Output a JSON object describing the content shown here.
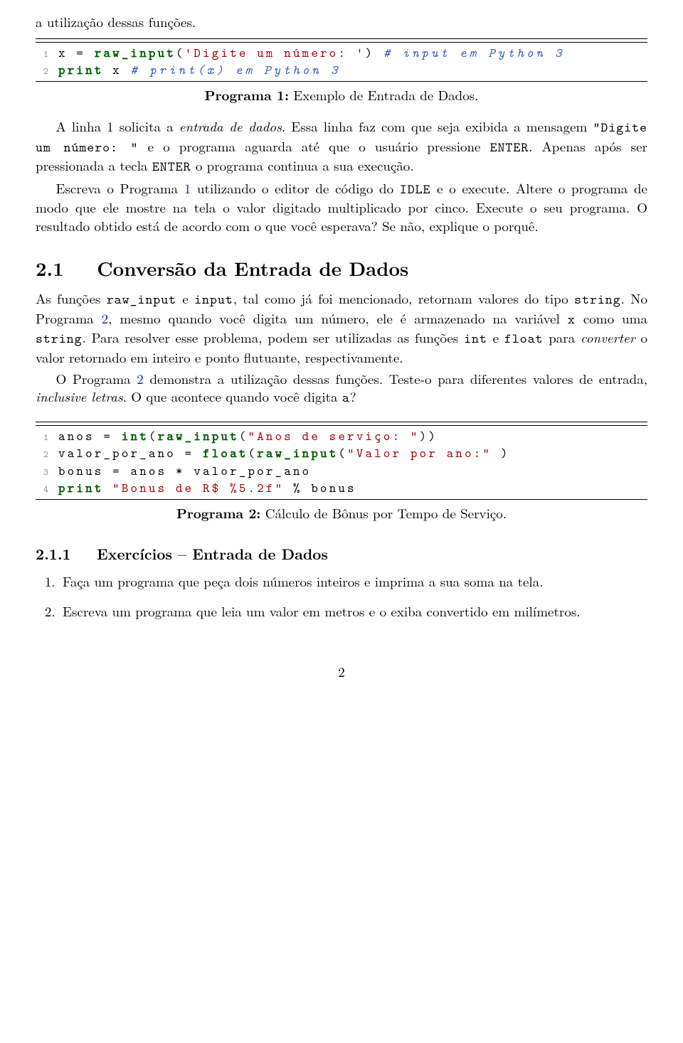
{
  "intro_line": "a utilização dessas funções.",
  "code1": {
    "lines": [
      {
        "n": "1",
        "pre": "x = ",
        "kw": "raw_input",
        "mid": "(",
        "str": "'Digite um número: '",
        "post": ") ",
        "comment": "# input em Python 3"
      },
      {
        "n": "2",
        "pre": "",
        "kw": "print",
        "mid": " x ",
        "str": "",
        "post": "",
        "comment": "# print(x) em Python 3"
      }
    ],
    "caption_label": "Programa 1:",
    "caption_text": " Exemplo de Entrada de Dados."
  },
  "p1_a": "A linha 1 solicita a ",
  "p1_b_italic": "entrada de dados",
  "p1_c": ". Essa linha faz com que seja exibida a mensagem ",
  "p1_tt1": "\"Digite um número:  \"",
  "p1_d": " e o programa aguarda até que o usuário pressione ",
  "p1_tt2": "ENTER",
  "p1_e": ". Apenas após ser pressionada a tecla ",
  "p1_tt3": "ENTER",
  "p1_f": " o programa continua a sua execução.",
  "p2_a": "Escreva o Programa ",
  "p2_ref": "1",
  "p2_b": " utilizando o editor de código do ",
  "p2_tt1": "IDLE",
  "p2_c": " e o execute. Altere o programa de modo que ele mostre na tela o valor digitado multiplicado por cinco. Execute o seu programa. O resultado obtido está de acordo com o que você esperava? Se não, explique o porquê.",
  "sec21_num": "2.1",
  "sec21_title": "Conversão da Entrada de Dados",
  "p3_a": "As funções ",
  "p3_tt1": "raw_input",
  "p3_b": " e ",
  "p3_tt2": "input",
  "p3_c": ", tal como já foi mencionado, retornam valores do tipo ",
  "p3_tt3": "string",
  "p3_d": ". No Programa ",
  "p3_ref": "2",
  "p3_e": ", mesmo quando você digita um número, ele é armazenado na variável ",
  "p3_tt4": "x",
  "p3_f": " como uma ",
  "p3_tt5": "string",
  "p3_g": ". Para resolver esse problema, podem ser utilizadas as funções ",
  "p3_tt6": "int",
  "p3_h": " e ",
  "p3_tt7": "float",
  "p3_i": " para ",
  "p3_it": "converter",
  "p3_j": " o valor retornado em inteiro e ponto flutuante, respectivamente.",
  "p4_a": "O Programa ",
  "p4_ref": "2",
  "p4_b": " demonstra a utilização dessas funções. Teste-o para diferentes valores de entrada, ",
  "p4_it": "inclusive letras",
  "p4_c": ". O que acontece quando você digita ",
  "p4_tt": "a",
  "p4_d": "?",
  "code2": {
    "lines": [
      {
        "n": "1",
        "text_parts": [
          {
            "t": "anos = "
          },
          {
            "t": "int",
            "c": "kw"
          },
          {
            "t": "("
          },
          {
            "t": "raw_input",
            "c": "kw"
          },
          {
            "t": "("
          },
          {
            "t": "\"Anos de serviço: \"",
            "c": "st"
          },
          {
            "t": "))"
          }
        ]
      },
      {
        "n": "2",
        "text_parts": [
          {
            "t": "valor_por_ano = "
          },
          {
            "t": "float",
            "c": "kw"
          },
          {
            "t": "("
          },
          {
            "t": "raw_input",
            "c": "kw"
          },
          {
            "t": "("
          },
          {
            "t": "\"Valor por ano:\"",
            "c": "st"
          },
          {
            "t": " )"
          }
        ]
      },
      {
        "n": "3",
        "text_parts": [
          {
            "t": "bonus = anos * valor_por_ano"
          }
        ]
      },
      {
        "n": "4",
        "text_parts": [
          {
            "t": "print",
            "c": "kw"
          },
          {
            "t": " "
          },
          {
            "t": "\"Bonus de R$ %5.2f\"",
            "c": "st"
          },
          {
            "t": " % bonus"
          }
        ]
      }
    ],
    "caption_label": "Programa 2:",
    "caption_text": " Cálculo de Bônus por Tempo de Serviço."
  },
  "sec211_num": "2.1.1",
  "sec211_title": "Exercícios – Entrada de Dados",
  "ex1": "Faça um programa que peça dois números inteiros e imprima a sua soma na tela.",
  "ex2": "Escreva um programa que leia um valor em metros e o exiba convertido em milímetros.",
  "page_number": "2"
}
